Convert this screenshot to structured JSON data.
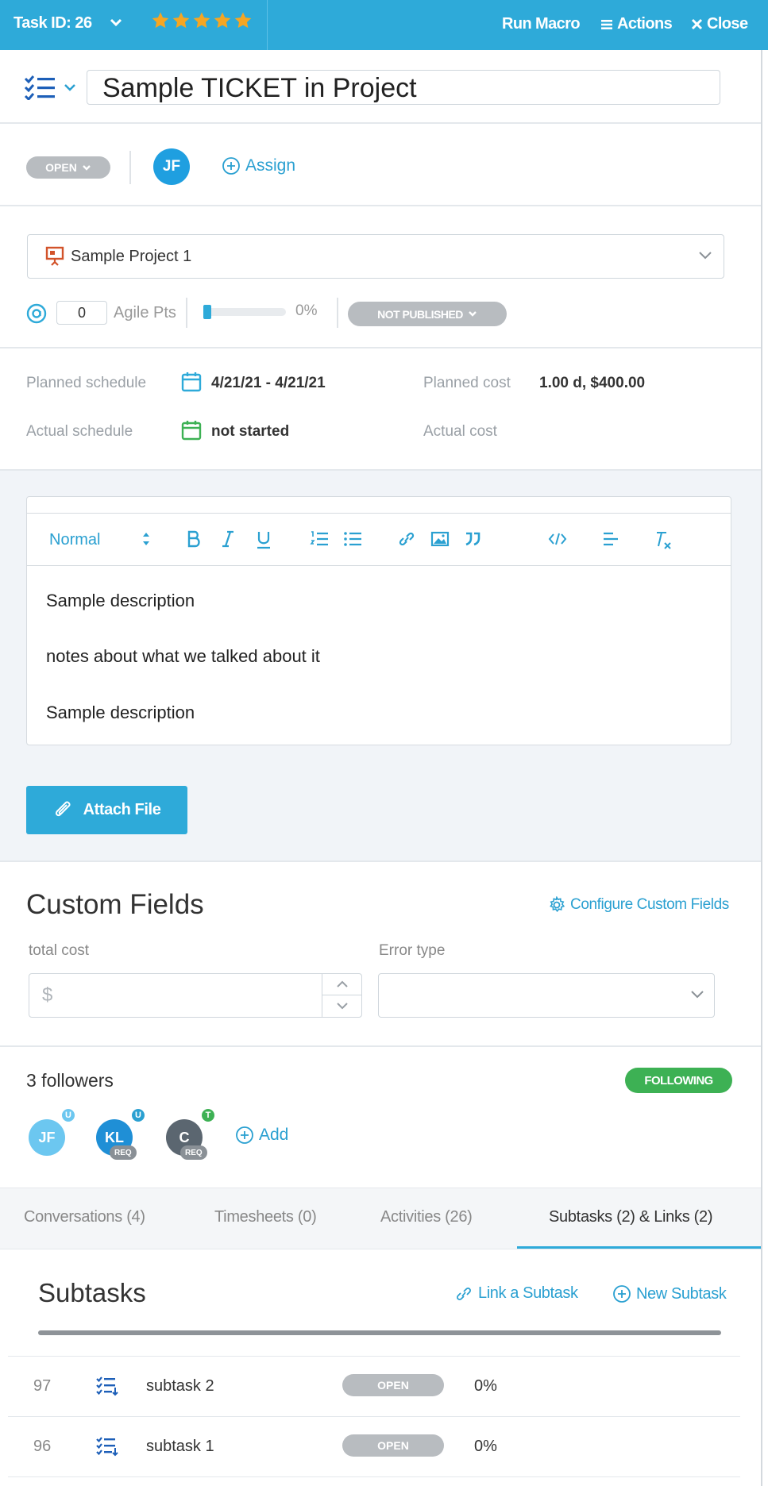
{
  "header": {
    "task_id": "Task ID: 26",
    "rating_stars": 5,
    "run_macro": "Run Macro",
    "actions": "Actions",
    "close": "Close"
  },
  "title": {
    "value": "Sample TICKET in Project"
  },
  "status": {
    "label": "OPEN",
    "assignee_initials": "JF",
    "assign_label": "Assign"
  },
  "project": {
    "name": "Sample Project 1"
  },
  "agile": {
    "points": "0",
    "label": "Agile Pts",
    "progress_value": 0,
    "progress_label": "0%",
    "publish_status": "NOT PUBLISHED"
  },
  "schedule": {
    "planned_label": "Planned schedule",
    "planned_value": "4/21/21 - 4/21/21",
    "actual_label": "Actual schedule",
    "actual_value": "not started",
    "planned_cost_label": "Planned cost",
    "planned_cost_value": "1.00 d, $400.00",
    "actual_cost_label": "Actual cost"
  },
  "editor": {
    "format": "Normal",
    "lines": [
      "Sample description",
      "notes about what we talked about it",
      "Sample description"
    ]
  },
  "attach": {
    "label": "Attach File"
  },
  "custom_fields": {
    "title": "Custom Fields",
    "configure_label": "Configure Custom Fields",
    "total_cost_label": "total cost",
    "total_cost_placeholder": "$",
    "error_type_label": "Error type"
  },
  "followers": {
    "title": "3 followers",
    "following_label": "FOLLOWING",
    "list": [
      {
        "initials": "JF",
        "badge": "U",
        "color": "#6cc7f0",
        "badge_color": "#6cc7f0"
      },
      {
        "initials": "KL",
        "badge": "U",
        "color": "#1f8fd6",
        "badge_color": "#2aa0d1",
        "tag": "REQ"
      },
      {
        "initials": "C",
        "badge": "T",
        "color": "#5b6670",
        "badge_color": "#3db154",
        "tag": "REQ"
      }
    ],
    "add_label": "Add"
  },
  "tabs": [
    {
      "label": "Conversations (4)"
    },
    {
      "label": "Timesheets (0)"
    },
    {
      "label": "Activities (26)"
    },
    {
      "label": "Subtasks (2) & Links (2)"
    }
  ],
  "subtasks": {
    "title": "Subtasks",
    "link_label": "Link a Subtask",
    "new_label": "New Subtask",
    "rows": [
      {
        "id": "97",
        "name": "subtask 2",
        "status": "OPEN",
        "progress": "0%"
      },
      {
        "id": "96",
        "name": "subtask 1",
        "status": "OPEN",
        "progress": "0%"
      }
    ]
  },
  "colors": {
    "accent": "#2eaad9",
    "link": "#2aa0d1",
    "star": "#f5a623",
    "success": "#3db154",
    "pill_gray": "#b8bcc0"
  },
  "icons": [
    "chevron-down-icon",
    "star-icon",
    "list-icon",
    "close-icon",
    "checklist-icon",
    "plus-circle-icon",
    "presentation-icon",
    "agile-icon",
    "calendar-icon",
    "bold-icon",
    "italic-icon",
    "underline-icon",
    "ordered-list-icon",
    "bullet-list-icon",
    "link-icon",
    "image-icon",
    "quote-icon",
    "code-icon",
    "align-icon",
    "clear-format-icon",
    "paperclip-icon",
    "gear-icon",
    "subtask-icon"
  ]
}
